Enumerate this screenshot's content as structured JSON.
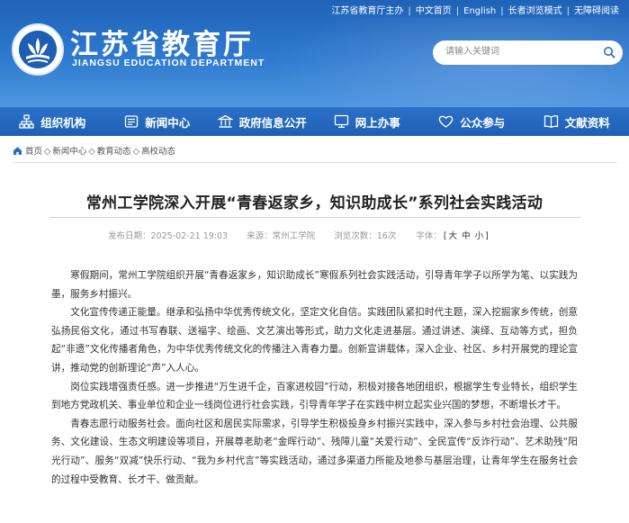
{
  "toplinks": [
    "江苏省教育厅主办",
    "中文首页",
    "English",
    "长者浏览模式",
    "无障碍阅读"
  ],
  "header": {
    "title": "江苏省教育厅",
    "subtitle_en": "JIANGSU EDUCATION DEPARTMENT"
  },
  "search": {
    "placeholder": "请输入关键词"
  },
  "nav": [
    {
      "label": "组织机构",
      "icon": "org-chart-icon"
    },
    {
      "label": "新闻中心",
      "icon": "news-icon"
    },
    {
      "label": "政府信息公开",
      "icon": "government-building-icon"
    },
    {
      "label": "网上办事",
      "icon": "monitor-icon"
    },
    {
      "label": "公众参与",
      "icon": "heart-icon"
    },
    {
      "label": "文献资料",
      "icon": "book-icon"
    }
  ],
  "breadcrumb": [
    "首页",
    "新闻中心",
    "教育动态",
    "高校动态"
  ],
  "article": {
    "title": "常州工学院深入开展“青春返家乡，知识助成长”系列社会实践活动",
    "meta": {
      "date": "发布日期：2025-02-21 19:03",
      "source": "来源：常州工学院",
      "views": "浏览次数：16次",
      "font_label": "字体：",
      "font_sizes": [
        "大",
        "中",
        "小"
      ]
    },
    "paragraphs": [
      "寒假期间，常州工学院组织开展“青春返家乡，知识助成长”寒假系列社会实践活动，引导青年学子以所学为笔、以实践为墨，服务乡村振兴。",
      "文化宣传传递正能量。继承和弘扬中华优秀传统文化，坚定文化自信。实践团队紧扣时代主题，深入挖掘家乡传统，创意弘扬民俗文化，通过书写春联、送福字、绘画、文艺演出等形式，助力文化走进基层。通过讲述、演绎、互动等方式，担负起“非遗”文化传播者角色，为中华优秀传统文化的传播注入青春力量。创新宣讲载体，深入企业、社区、乡村开展党的理论宣讲，推动党的创新理论“声”入人心。",
      "岗位实践增强责任感。进一步推进“万生进千企，百家进校园”行动，积极对接各地团组织，根据学生专业特长，组织学生到地方党政机关、事业单位和企业一线岗位进行社会实践，引导青年学子在实践中树立起实业兴国的梦想，不断增长才干。",
      "青春志愿行动服务社会。面向社区和居民实际需求，引导学生积极投身乡村振兴实践中，深入参与乡村社会治理、公共服务、文化建设、生态文明建设等项目，开展尊老助老“金晖行动”、残障儿童“关爱行动”、全民宣传“反诈行动”、艺术助残“阳光行动”、服务“双减”快乐行动、“我为乡村代言”等实践活动，通过多渠道力所能及地参与基层治理，让青年学生在服务社会的过程中受教育、长才干、做贡献。"
    ]
  },
  "colors": {
    "header_blue": "#1f63b8",
    "nav_blue": "#1e5fb5",
    "text": "#333333",
    "meta_gray": "#999999"
  }
}
